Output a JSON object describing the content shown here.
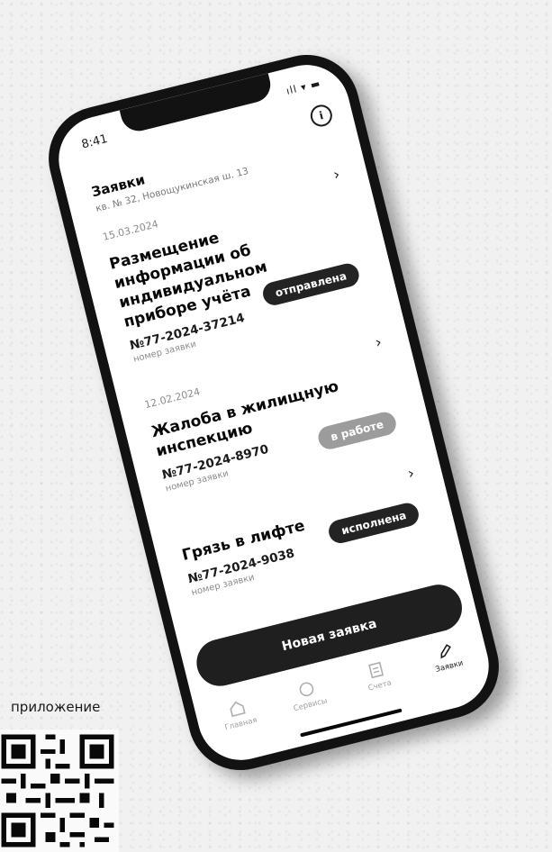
{
  "status_bar": {
    "time": "8:41",
    "icons": "ıll ▾ ▬"
  },
  "header": {
    "title": "Заявки",
    "address": "кв. № 32, Новощукинская ш. 13"
  },
  "requests": [
    {
      "date": "15.03.2024",
      "title": "Размещение информации об индивидуальном приборе учёта",
      "number": "№77-2024-37214",
      "number_label": "номер заявки",
      "status": "отправлена"
    },
    {
      "date": "12.02.2024",
      "title": "Жалоба в жилищную инспекцию",
      "number": "№77-2024-8970",
      "number_label": "номер заявки",
      "status": "в работе"
    },
    {
      "date": "",
      "title": "Грязь в лифте",
      "number": "№77-2024-9038",
      "number_label": "номер заявки",
      "status": "исполнена"
    }
  ],
  "new_request_button": "Новая заявка",
  "tabs": [
    {
      "label": "Главная"
    },
    {
      "label": "Сервисы"
    },
    {
      "label": "Счета"
    },
    {
      "label": "Заявки"
    }
  ],
  "promo": {
    "text": "приложение"
  }
}
